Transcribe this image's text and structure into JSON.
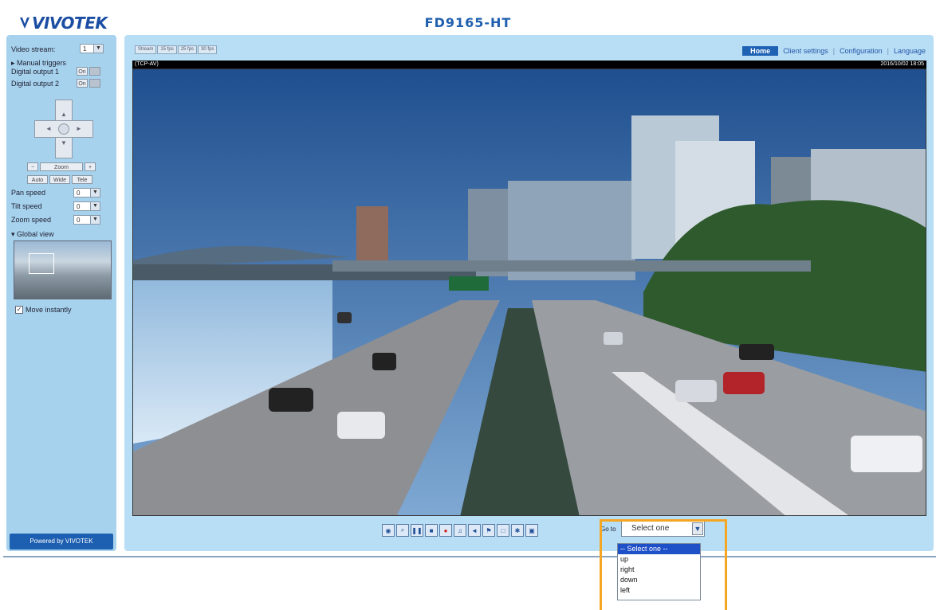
{
  "brand": {
    "logo": "VIVOTEK",
    "model": "FD9165-HT"
  },
  "sidebar": {
    "video_stream_label": "Video stream:",
    "video_stream_value": "1",
    "manual_triggers": "Manual triggers",
    "digital_output_1": "Digital output 1",
    "digital_output_2": "Digital output 2",
    "on_label": "On",
    "zoom_label": "Zoom",
    "zoom_out": "−",
    "zoom_in": "+",
    "buttons": [
      "Auto",
      "Wide",
      "Tele"
    ],
    "pan_speed_label": "Pan speed",
    "pan_speed_value": "0",
    "tilt_speed_label": "Tilt speed",
    "tilt_speed_value": "0",
    "zoom_speed_label": "Zoom speed",
    "zoom_speed_value": "0",
    "global_view": "Global view",
    "move_instantly": "Move instantly",
    "powered_by": "Powered by VIVOTEK"
  },
  "tabs": [
    "Stream",
    "15 fps",
    "25 fps",
    "30 fps"
  ],
  "nav": {
    "home": "Home",
    "client_settings": "Client settings",
    "configuration": "Configuration",
    "language": "Language"
  },
  "video": {
    "protocol": "(TCP-AV)",
    "timestamp": "2016/10/02 18:05"
  },
  "toolbar": {
    "icons": [
      "snapshot-icon",
      "digital-zoom-icon",
      "pause-icon",
      "stop-icon",
      "record-icon",
      "volume-icon",
      "mute-icon",
      "talk-icon",
      "mic-mute-icon",
      "fullscreen-icon",
      "global-view-icon"
    ],
    "glyphs": [
      "◉",
      "⌕",
      "❚❚",
      "■",
      "●",
      "♫",
      "◄",
      "⚑",
      "□",
      "✱",
      "▣"
    ]
  },
  "goto": {
    "label": "Go to",
    "selected": "Select one",
    "options": [
      "-- Select one --",
      "up",
      "right",
      "down",
      "left"
    ]
  }
}
